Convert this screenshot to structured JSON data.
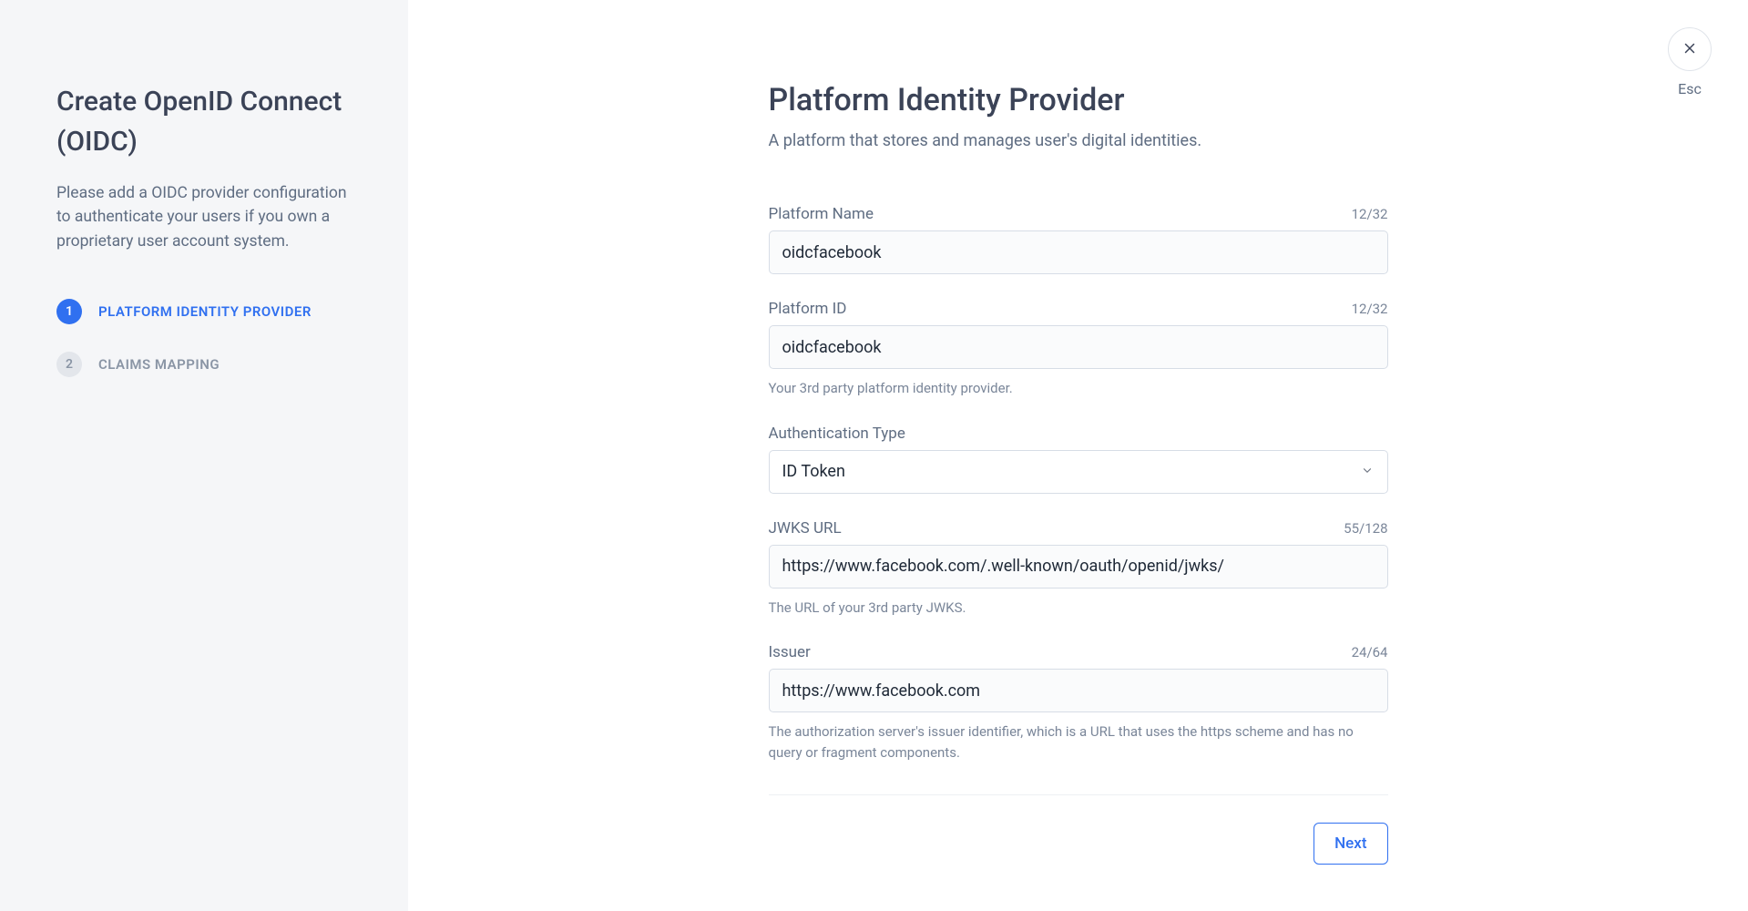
{
  "sidebar": {
    "title": "Create OpenID Connect (OIDC)",
    "description": "Please add a OIDC provider configuration to authenticate your users if you own a proprietary user account system.",
    "steps": [
      {
        "num": "1",
        "label": "PLATFORM IDENTITY PROVIDER"
      },
      {
        "num": "2",
        "label": "CLAIMS MAPPING"
      }
    ]
  },
  "close": {
    "esc": "Esc"
  },
  "main": {
    "title": "Platform Identity Provider",
    "subtitle": "A platform that stores and manages user's digital identities."
  },
  "fields": {
    "platform_name": {
      "label": "Platform Name",
      "counter": "12/32",
      "value": "oidcfacebook"
    },
    "platform_id": {
      "label": "Platform ID",
      "counter": "12/32",
      "value": "oidcfacebook",
      "help": "Your 3rd party platform identity provider."
    },
    "auth_type": {
      "label": "Authentication Type",
      "value": "ID Token"
    },
    "jwks": {
      "label": "JWKS URL",
      "counter": "55/128",
      "value": "https://www.facebook.com/.well-known/oauth/openid/jwks/",
      "help": "The URL of your 3rd party JWKS."
    },
    "issuer": {
      "label": "Issuer",
      "counter": "24/64",
      "value": "https://www.facebook.com",
      "help": "The authorization server's issuer identifier, which is a URL that uses the https scheme and has no query or fragment components."
    }
  },
  "actions": {
    "next": "Next"
  }
}
